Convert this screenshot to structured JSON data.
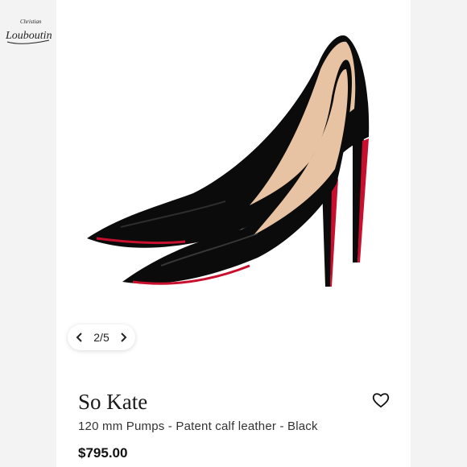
{
  "brand": {
    "logo_top": "Christian",
    "logo_main": "Louboutin"
  },
  "gallery": {
    "counter": "2/5",
    "prev_icon": "chevron-left-icon",
    "next_icon": "chevron-right-icon"
  },
  "product": {
    "name": "So Kate",
    "description": "120 mm Pumps - Patent calf leather - Black",
    "price": "$795.00",
    "wishlist_icon": "heart-outline-icon"
  },
  "colors": {
    "sole_red": "#c8102e",
    "patent_black": "#0b0b0b",
    "lining_nude": "#e8c3a3"
  }
}
